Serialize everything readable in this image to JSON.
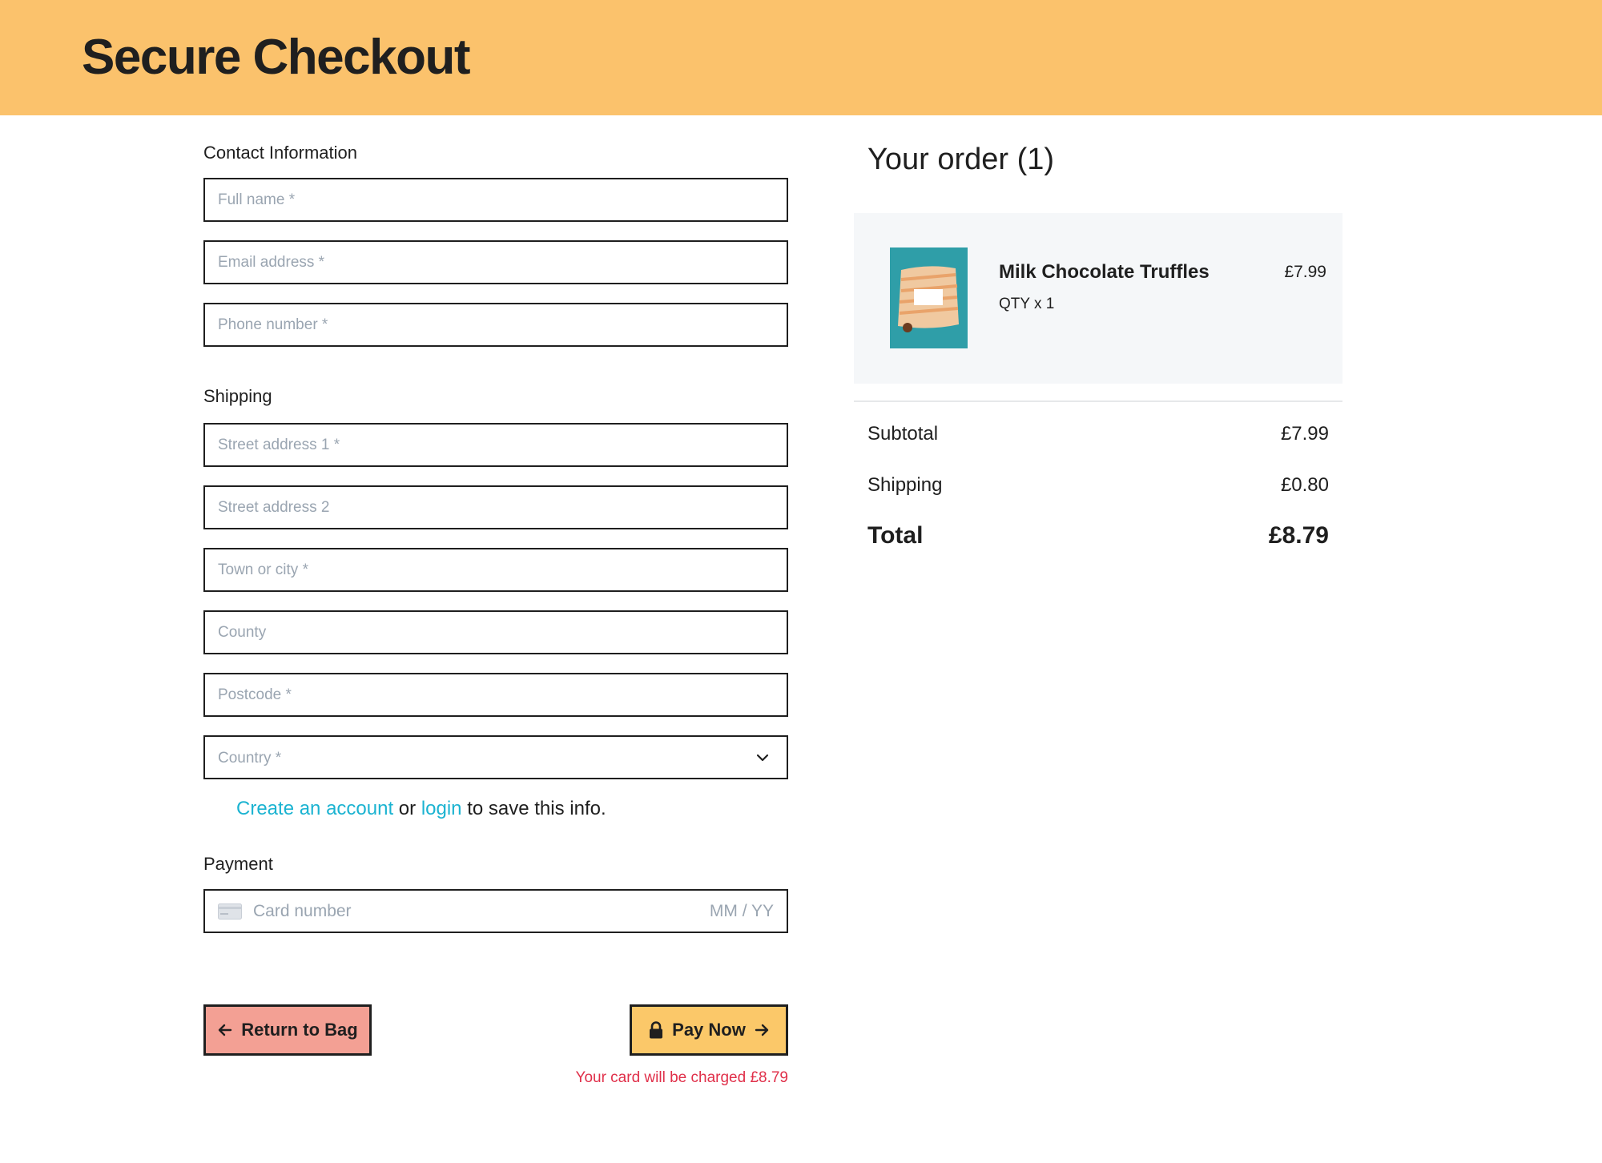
{
  "header": {
    "title": "Secure Checkout"
  },
  "contact": {
    "label": "Contact Information",
    "full_name_placeholder": "Full name *",
    "email_placeholder": "Email address *",
    "phone_placeholder": "Phone number *"
  },
  "shipping": {
    "label": "Shipping",
    "street1_placeholder": "Street address 1 *",
    "street2_placeholder": "Street address 2",
    "town_placeholder": "Town or city *",
    "county_placeholder": "County",
    "postcode_placeholder": "Postcode *",
    "country_placeholder": "Country *"
  },
  "account": {
    "create_link": "Create an account",
    "or_text": " or ",
    "login_link": "login",
    "suffix_text": " to save this info."
  },
  "payment": {
    "label": "Payment",
    "card_placeholder": "Card number",
    "expiry_placeholder": "MM / YY"
  },
  "actions": {
    "return_label": "Return to Bag",
    "pay_label": "Pay Now",
    "charge_note": "Your card will be charged £8.79"
  },
  "order": {
    "title": "Your order (1)",
    "item": {
      "name": "Milk Chocolate Truffles",
      "qty": "QTY x 1",
      "price": "£7.99"
    },
    "subtotal_label": "Subtotal",
    "subtotal_value": "£7.99",
    "shipping_label": "Shipping",
    "shipping_value": "£0.80",
    "total_label": "Total",
    "total_value": "£8.79"
  },
  "colors": {
    "header_bg": "#fbc26c",
    "link": "#1bb3d1",
    "return_button": "#f3a094",
    "pay_button": "#fbc869",
    "charge_note": "#e0304a"
  }
}
